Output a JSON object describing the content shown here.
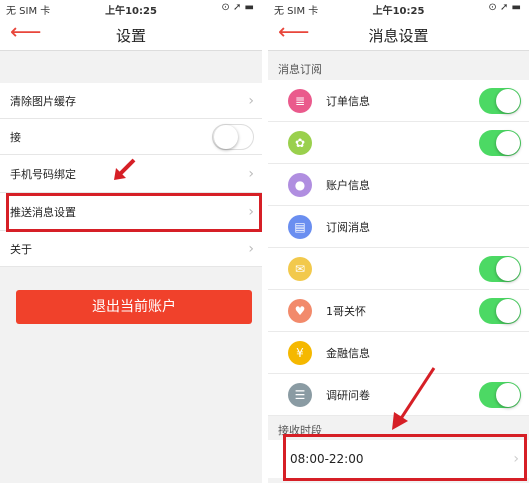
{
  "left": {
    "status": {
      "carrier": "无 SIM 卡 ",
      "time": "上午10:25",
      "right": "⊙ ➚ ▬"
    },
    "title": "设置",
    "rows": [
      {
        "label": "清除图片缓存"
      },
      {
        "label": "接"
      },
      {
        "label": "手机号码绑定"
      },
      {
        "label": "推送消息设置"
      },
      {
        "label": "关于"
      }
    ],
    "toggle_on": false,
    "logout": "退出当前账户"
  },
  "right": {
    "status": {
      "carrier": "无 SIM 卡 ",
      "time": "上午10:25",
      "right": "⊙ ➚ ▬"
    },
    "title": "消息设置",
    "section_subscribe": "消息订阅",
    "items": [
      {
        "label": "订单信息",
        "icon": "order-icon",
        "color": "#ea5a8c",
        "toggle": true
      },
      {
        "label": "",
        "icon": "promo-icon",
        "color": "#9ad04d",
        "toggle": true
      },
      {
        "label": "账户信息",
        "icon": "account-icon",
        "color": "#b08ee0",
        "toggle": false
      },
      {
        "label": "订阅消息",
        "icon": "subscribe-icon",
        "color": "#6a8ef0",
        "toggle": false
      },
      {
        "label": "",
        "icon": "notice-icon",
        "color": "#f2c94c",
        "toggle": true
      },
      {
        "label": "1哥关怀",
        "icon": "heart-icon",
        "color": "#f28a6b",
        "toggle": true
      },
      {
        "label": "金融信息",
        "icon": "finance-icon",
        "color": "#f5b800",
        "toggle": false
      },
      {
        "label": "调研问卷",
        "icon": "survey-icon",
        "color": "#8a9ba3",
        "toggle": true
      }
    ],
    "section_time": "接收时段",
    "time_value": "08:00-22:00"
  },
  "colors": {
    "accent": "#e8463b",
    "toggle_on": "#4cd964",
    "button": "#f0412b",
    "highlight": "#d61f26"
  }
}
